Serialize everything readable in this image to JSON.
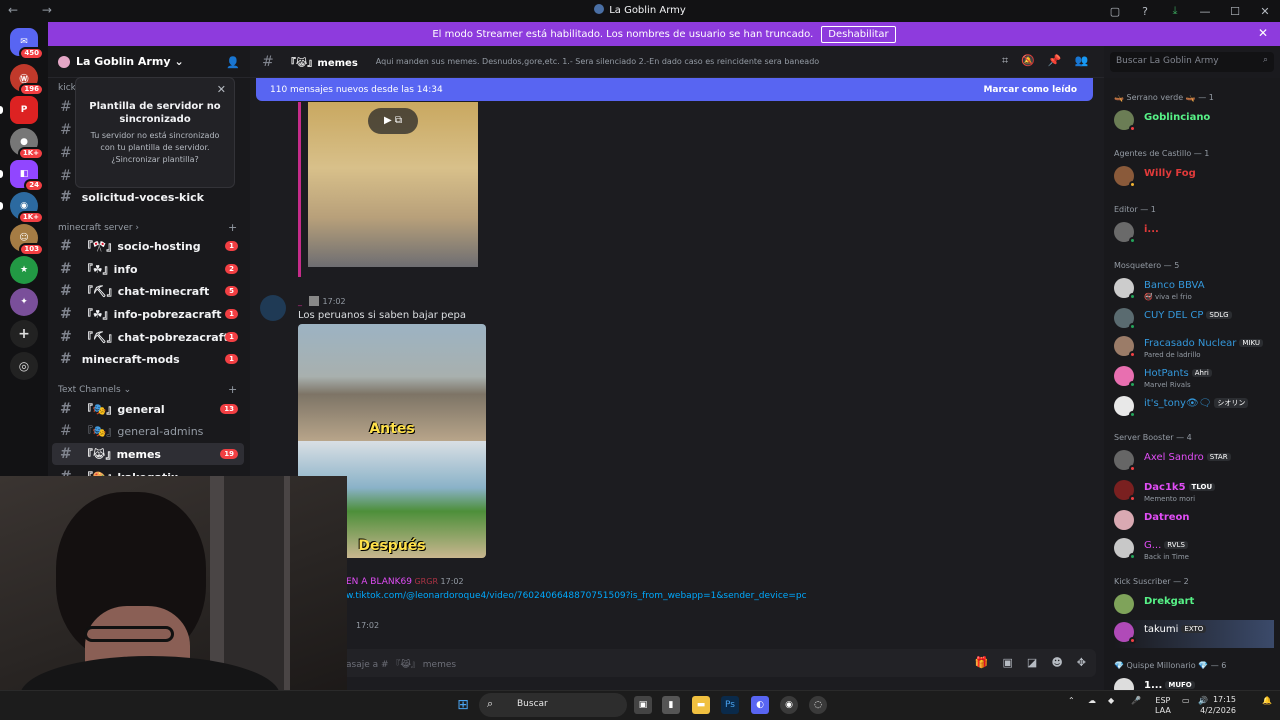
{
  "window": {
    "title": "La Goblin Army",
    "nav": "← →"
  },
  "banner": {
    "text": "El modo Streamer está habilitado. Los nombres de usuario se han truncado.",
    "button": "Deshabilitar"
  },
  "servers": [
    {
      "badge": "450",
      "color": "#5865f2"
    },
    {
      "badge": "196",
      "color": "#c0392b"
    },
    {
      "badge": "",
      "color": "#d22"
    },
    {
      "badge": "1K+",
      "color": "#777"
    },
    {
      "badge": "24",
      "color": "#9146ff"
    },
    {
      "badge": "1K+",
      "color": "#2c6aa0"
    },
    {
      "badge": "103",
      "color": "#a57c44"
    },
    {
      "badge": "",
      "color": "#229944"
    },
    {
      "badge": "",
      "color": "#7a4f9a"
    }
  ],
  "server": {
    "name": "La Goblin Army"
  },
  "popup": {
    "title": "Plantilla de servidor no sincronizado",
    "message": "Tu servidor no está sincronizado con tu plantilla de servidor. ¿Sincronizar plantilla?"
  },
  "channels": {
    "top_cut": "kick",
    "solicitud": "solicitud-voces-kick",
    "cat_minecraft": "minecraft server",
    "minecraft": [
      {
        "name": "『🎌』socio-hosting",
        "count": "1"
      },
      {
        "name": "『☘』info",
        "count": "2"
      },
      {
        "name": "『⛏』chat-minecraft",
        "count": "5"
      },
      {
        "name": "『☘』info-pobrezacraft",
        "count": "1"
      },
      {
        "name": "『⛏』chat-pobrezacraft",
        "count": "1"
      },
      {
        "name": "minecraft-mods",
        "count": "1"
      }
    ],
    "cat_text": "Text Channels",
    "text": [
      {
        "name": "『🎭』general",
        "count": "13"
      },
      {
        "name": "『🎭』general-admins",
        "count": ""
      },
      {
        "name": "『😹』memes",
        "count": "19"
      },
      {
        "name": "『🎨』kakegatix",
        "count": ""
      }
    ]
  },
  "header": {
    "channel": "『😹』memes",
    "topic": "Aqui manden sus memes. Desnudos,gore,etc. 1.- Sera silenciado 2.-En dado caso es reincidente sera baneado",
    "search": "Buscar La Goblin Army"
  },
  "chat": {
    "new_messages": "110 mensajes nuevos desde las 14:34",
    "mark_read": "Marcar como leído",
    "msg1": {
      "author": "_",
      "time": "17:02",
      "text": "Los peruanos si saben bajar pepa",
      "before": "Antes",
      "after": "Después"
    },
    "msg2": {
      "author": "EN A BLANK69",
      "tag": "GRGR",
      "time": "17:02",
      "link": "w.tiktok.com/@leonardoroque4/video/7602406648870751509?is_from_webapp=1&sender_device=pc"
    },
    "msg3": {
      "time": "17:02"
    },
    "composer": "asaje a # 『😹』 memes"
  },
  "members": {
    "roles": [
      {
        "name": "🛶 Serrano verde 🛶 — 1"
      },
      {
        "name": "Agentes de Castillo — 1"
      },
      {
        "name": "Editor — 1"
      },
      {
        "name": "Mosquetero — 5"
      },
      {
        "name": "Server Booster — 4"
      },
      {
        "name": "Kick Suscriber — 2"
      },
      {
        "name": "💎 Quispe Millonario 💎 — 6"
      }
    ],
    "list": [
      {
        "name": "Goblinciano",
        "sub": "",
        "tag": "",
        "color": "#57f287"
      },
      {
        "name": "Willy Fog",
        "sub": "",
        "tag": "",
        "color": "#e03a3a"
      },
      {
        "name": "i...",
        "sub": "",
        "tag": "",
        "color": "#e03a3a"
      },
      {
        "name": "Banco BBVA",
        "sub": "🚭 viva el frio",
        "tag": "",
        "color": "#3498db"
      },
      {
        "name": "CUY DEL CP",
        "sub": "",
        "tag": "SDLG",
        "color": "#3498db"
      },
      {
        "name": "Fracasado Nuclear",
        "sub": "Pared de ladrillo",
        "tag": "MIKU",
        "color": "#3498db"
      },
      {
        "name": "HotPants",
        "sub": "Marvel Rivals",
        "tag": "Ahri",
        "color": "#3498db"
      },
      {
        "name": "it's_tony👁🗨",
        "sub": "",
        "tag": "シオリン",
        "color": "#3498db"
      },
      {
        "name": "Axel Sandro",
        "sub": "",
        "tag": "STAR",
        "color": "#e04df5"
      },
      {
        "name": "Dac1k5",
        "sub": "Memento mori",
        "tag": "TLOU",
        "color": "#e04df5"
      },
      {
        "name": "Datreon",
        "sub": "",
        "tag": "",
        "color": "#e04df5"
      },
      {
        "name": "G...",
        "sub": "Back in Time",
        "tag": "RVLS",
        "color": "#e04df5"
      },
      {
        "name": "Drekgart",
        "sub": "",
        "tag": "",
        "color": "#57f287"
      },
      {
        "name": "takumi",
        "sub": "",
        "tag": "EXTO",
        "color": "#fff"
      },
      {
        "name": "1...",
        "sub": "",
        "tag": "MUFO",
        "color": "#fff"
      }
    ]
  },
  "taskbar": {
    "search": "Buscar",
    "lang1": "ESP",
    "lang2": "LAA",
    "time": "17:15",
    "date": "4/2/2026"
  }
}
